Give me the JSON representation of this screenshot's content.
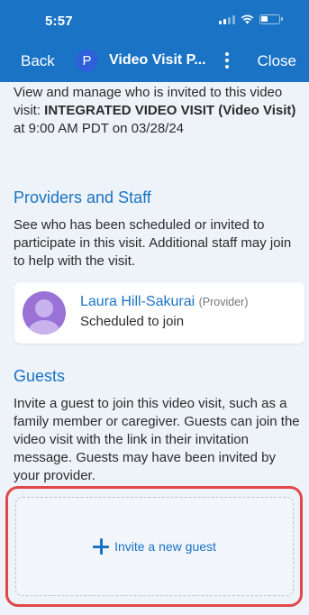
{
  "status_bar": {
    "time": "5:57"
  },
  "nav": {
    "back_label": "Back",
    "avatar_letter": "P",
    "title": "Video Visit P...",
    "more_icon": "vertical-ellipsis-icon",
    "close_label": "Close"
  },
  "intro": {
    "text_before": "View and manage who is invited to this video visit: ",
    "visit_name": "INTEGRATED VIDEO VISIT (Video Visit)",
    "text_after": " at 9:00 AM PDT on 03/28/24"
  },
  "providers": {
    "title": "Providers and Staff",
    "description": "See who has been scheduled or invited to participate in this visit. Additional staff may join to help with the visit.",
    "items": [
      {
        "name": "Laura Hill-Sakurai",
        "role": "(Provider)",
        "status": "Scheduled to join"
      }
    ]
  },
  "guests": {
    "title": "Guests",
    "description": "Invite a guest to join this video visit, such as a family member or caregiver. Guests can join the video visit with the link in their invitation message. Guests may have been invited by your provider.",
    "invite_label": "Invite a new guest"
  },
  "colors": {
    "accent": "#1a73c4",
    "background": "#eef3f9",
    "highlight_outline": "#e14848",
    "provider_avatar": "#9a72d6"
  }
}
